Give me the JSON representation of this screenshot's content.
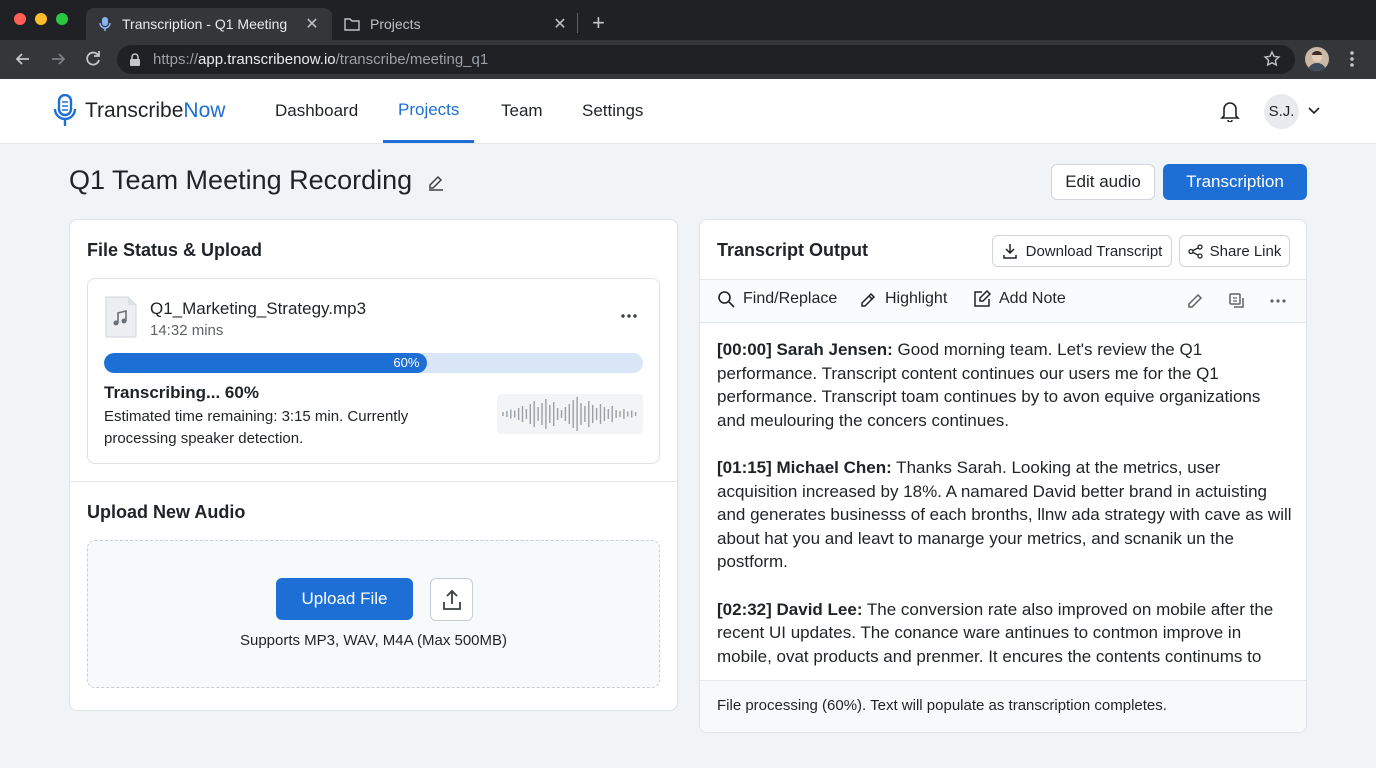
{
  "browser": {
    "tabs": [
      {
        "title": "Transcription - Q1 Meeting"
      },
      {
        "title": "Projects"
      }
    ],
    "url_prefix": "https://",
    "url_host": "app.transcribenow.io",
    "url_path": "/transcribe/meeting_q1"
  },
  "app": {
    "logo_a": "Transcribe",
    "logo_b": "Now",
    "nav": [
      "Dashboard",
      "Projects",
      "Team",
      "Settings"
    ],
    "user_initials": "S.J."
  },
  "page": {
    "title": "Q1 Team Meeting Recording",
    "edit_audio_label": "Edit audio",
    "transcription_label": "Transcription"
  },
  "file_panel": {
    "heading": "File Status & Upload",
    "file_name": "Q1_Marketing_Strategy.mp3",
    "duration": "14:32 mins",
    "progress": 0.6,
    "progress_label": "60%",
    "status": "Transcribing... 60%",
    "eta": "Estimated time remaining: 3:15 min. Currently processing speaker detection.",
    "upload_heading": "Upload New Audio",
    "upload_button": "Upload File",
    "supports": "Supports MP3, WAV, M4A (Max 500MB)"
  },
  "transcript_panel": {
    "heading": "Transcript Output",
    "download_label": "Download Transcript",
    "share_label": "Share Link",
    "tools": [
      "Find/Replace",
      "Highlight",
      "Add Note"
    ],
    "entries": [
      {
        "speaker": "[00:00] Sarah Jensen:",
        "text": " Good morning team. Let's review the Q1 performance. Transcript content continues our users me for the Q1 performance. Transcript toam continues by to avon equive organizations and meulouring the concers continues."
      },
      {
        "speaker": "[01:15] Michael Chen:",
        "text": " Thanks Sarah. Looking at the metrics, user acquisition increased by 18%. A namared David better brand in actuisting and generates businesss of each bronths, llnw ada strategy with cave as will about hat you and leavt to manarge your metrics, and scnanik un the postform."
      },
      {
        "speaker": "[02:32] David Lee:",
        "text": " The conversion rate also improved on mobile after the recent UI updates. The conance ware antinues to contmon improve in mobile, ovat products and prenmer. It encures the contents continums to"
      }
    ],
    "footer": "File processing (60%). Text will populate as transcription completes."
  }
}
